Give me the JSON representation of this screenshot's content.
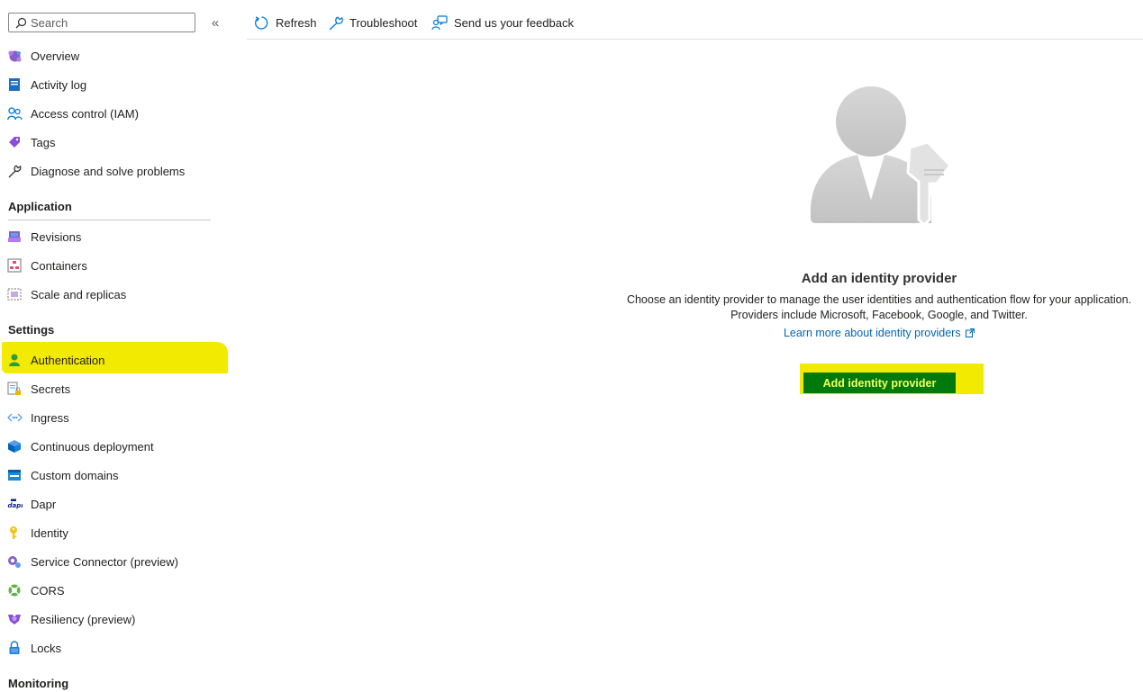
{
  "search": {
    "placeholder": "Search"
  },
  "collapse_glyph": "«",
  "sidebar": {
    "top_items": [
      {
        "label": "Overview",
        "icon": "overview-icon"
      },
      {
        "label": "Activity log",
        "icon": "activity-log-icon"
      },
      {
        "label": "Access control (IAM)",
        "icon": "people-icon"
      },
      {
        "label": "Tags",
        "icon": "tag-icon"
      },
      {
        "label": "Diagnose and solve problems",
        "icon": "wrench-icon"
      }
    ],
    "sections": [
      {
        "title": "Application",
        "items": [
          {
            "label": "Revisions",
            "icon": "revisions-icon"
          },
          {
            "label": "Containers",
            "icon": "containers-icon"
          },
          {
            "label": "Scale and replicas",
            "icon": "scale-icon"
          }
        ]
      },
      {
        "title": "Settings",
        "items": [
          {
            "label": "Authentication",
            "icon": "authentication-icon",
            "selected": true
          },
          {
            "label": "Secrets",
            "icon": "secrets-icon"
          },
          {
            "label": "Ingress",
            "icon": "ingress-icon"
          },
          {
            "label": "Continuous deployment",
            "icon": "deployment-cube-icon"
          },
          {
            "label": "Custom domains",
            "icon": "custom-domains-icon"
          },
          {
            "label": "Dapr",
            "icon": "dapr-icon"
          },
          {
            "label": "Identity",
            "icon": "identity-key-icon"
          },
          {
            "label": "Service Connector (preview)",
            "icon": "service-connector-icon"
          },
          {
            "label": "CORS",
            "icon": "cors-icon"
          },
          {
            "label": "Resiliency (preview)",
            "icon": "resiliency-icon"
          },
          {
            "label": "Locks",
            "icon": "lock-icon"
          }
        ]
      },
      {
        "title": "Monitoring",
        "items": []
      }
    ]
  },
  "toolbar": {
    "refresh_label": "Refresh",
    "troubleshoot_label": "Troubleshoot",
    "feedback_label": "Send us your feedback"
  },
  "main": {
    "title": "Add an identity provider",
    "description_line1": "Choose an identity provider to manage the user identities and authentication flow for your application.",
    "description_line2": "Providers include Microsoft, Facebook, Google, and Twitter.",
    "learn_more": "Learn more about identity providers",
    "add_button": "Add identity provider"
  },
  "colors": {
    "highlight": "#f2ea00",
    "button_bg": "#007a0c",
    "button_text": "#f4ff5e",
    "link": "#0067b8"
  }
}
